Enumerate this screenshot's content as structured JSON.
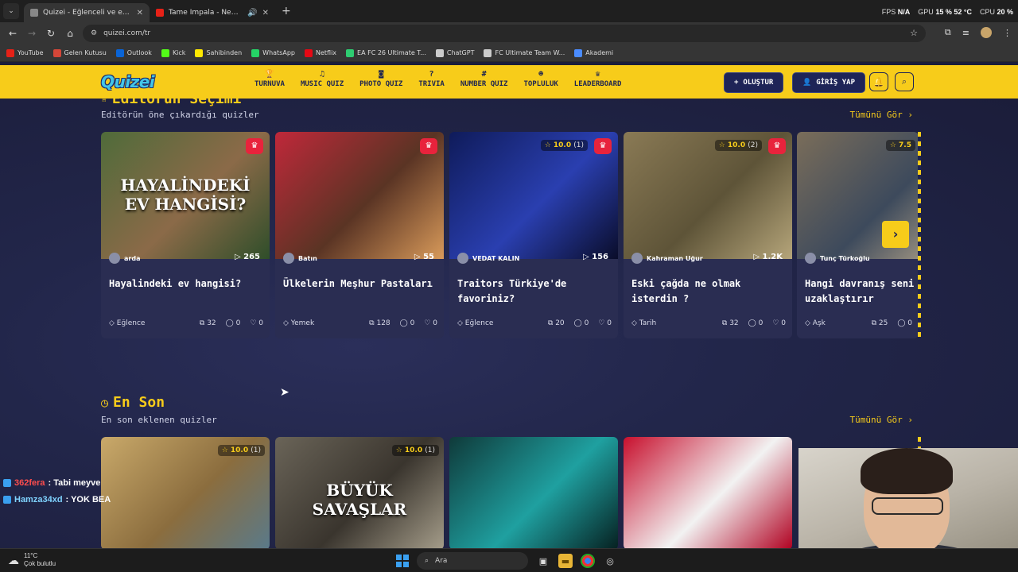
{
  "browser": {
    "tabs": [
      {
        "title": "Quizei - Eğlenceli ve etkileşimli",
        "active": true,
        "color": "#888888"
      },
      {
        "title": "Tame Impala - New Person, Sam",
        "active": false,
        "color": "#e62117"
      }
    ],
    "url": "quizei.com/tr",
    "stats": {
      "fps_label": "FPS",
      "fps_value": "N/A",
      "gpu_label": "GPU",
      "gpu_value": "15 % 52 °C",
      "cpu_label": "CPU",
      "cpu_value": "20 %"
    },
    "bookmarks": [
      {
        "label": "YouTube",
        "color": "#e62117"
      },
      {
        "label": "Gelen Kutusu",
        "color": "#d44638"
      },
      {
        "label": "Outlook",
        "color": "#0a64d6"
      },
      {
        "label": "Kick",
        "color": "#53fc18"
      },
      {
        "label": "Sahibinden",
        "color": "#ffe800"
      },
      {
        "label": "WhatsApp",
        "color": "#25d366"
      },
      {
        "label": "Netflix",
        "color": "#e50914"
      },
      {
        "label": "EA FC 26 Ultimate T...",
        "color": "#2ecc71"
      },
      {
        "label": "ChatGPT",
        "color": "#cccccc"
      },
      {
        "label": "FC Ultimate Team W...",
        "color": "#cccccc"
      },
      {
        "label": "Akademi",
        "color": "#4a8cff"
      }
    ]
  },
  "site": {
    "logo": "Quizei",
    "nav": [
      {
        "label": "TURNUVA",
        "icon": "trophy-icon",
        "glyph": "🏆"
      },
      {
        "label": "MUSIC QUIZ",
        "icon": "music-icon",
        "glyph": "♫"
      },
      {
        "label": "PHOTO QUIZ",
        "icon": "camera-icon",
        "glyph": "◙"
      },
      {
        "label": "TRIVIA",
        "icon": "question-icon",
        "glyph": "?"
      },
      {
        "label": "NUMBER QUIZ",
        "icon": "hash-icon",
        "glyph": "#"
      },
      {
        "label": "TOPLULUK",
        "icon": "users-icon",
        "glyph": "☻"
      },
      {
        "label": "LEADERBOARD",
        "icon": "medal-icon",
        "glyph": "♛"
      }
    ],
    "create_label": "OLUŞTUR",
    "login_label": "GİRİŞ YAP"
  },
  "editors": {
    "title": "Editörün Seçimi",
    "subtitle": "Editörün öne çıkardığı quizler",
    "see_all": "Tümünü Gör",
    "cards": [
      {
        "title": "Hayalindeki ev hangisi?",
        "author": "arda",
        "plays": "265",
        "category": "Eğlence",
        "questions": "32",
        "comments": "0",
        "likes": "0",
        "crown": true,
        "rating": "",
        "rating_count": "",
        "img_text": "HAYALİNDEKİ EV HANGİSİ?",
        "img_colors": [
          "#4f6b3a",
          "#8b6a48",
          "#2f4e2a"
        ]
      },
      {
        "title": "Ülkelerin Meşhur Pastaları",
        "author": "Batın",
        "plays": "55",
        "category": "Yemek",
        "questions": "128",
        "comments": "0",
        "likes": "0",
        "crown": true,
        "rating": "",
        "rating_count": "",
        "img_text": "",
        "img_colors": [
          "#c0283a",
          "#5a3424",
          "#d89a5a"
        ]
      },
      {
        "title": "Traitors Türkiye'de favoriniz?",
        "author": "VEDAT KALIN",
        "plays": "156",
        "category": "Eğlence",
        "questions": "20",
        "comments": "0",
        "likes": "0",
        "crown": true,
        "rating": "10.0",
        "rating_count": "(1)",
        "img_text": "",
        "img_colors": [
          "#0f1b5a",
          "#2a3fb0",
          "#0a0d2a"
        ]
      },
      {
        "title": "Eski çağda ne olmak isterdin ?",
        "author": "Kahraman Uğur",
        "plays": "1.2K",
        "category": "Tarih",
        "questions": "32",
        "comments": "0",
        "likes": "0",
        "crown": true,
        "rating": "10.0",
        "rating_count": "(2)",
        "img_text": "",
        "img_colors": [
          "#8a7a55",
          "#5e5438",
          "#b5a57a"
        ]
      },
      {
        "title": "Hangi davranış seni anında uzaklaştırır",
        "author": "Tunç Türkoğlu",
        "plays": "",
        "category": "Aşk",
        "questions": "25",
        "comments": "0",
        "likes": "",
        "crown": false,
        "rating": "7.5",
        "rating_count": "",
        "img_text": "",
        "img_colors": [
          "#7a6d5a",
          "#3d4a5c",
          "#c4b090"
        ]
      }
    ]
  },
  "latest": {
    "title": "En Son",
    "subtitle": "En son eklenen quizler",
    "see_all": "Tümünü Gör",
    "cards": [
      {
        "rating": "10.0",
        "rating_count": "(1)",
        "img_text": "",
        "img_colors": [
          "#c9a96a",
          "#8b6d3e",
          "#5a7a8a"
        ]
      },
      {
        "rating": "10.0",
        "rating_count": "(1)",
        "img_text": "BÜYÜK SAVAŞLAR",
        "img_colors": [
          "#6a6458",
          "#3a352e",
          "#a59d8a"
        ]
      },
      {
        "rating": "",
        "rating_count": "",
        "img_text": "",
        "img_colors": [
          "#0f3a3a",
          "#1fa0a0",
          "#062020"
        ]
      },
      {
        "rating": "",
        "rating_count": "",
        "img_text": "",
        "img_colors": [
          "#c8102e",
          "#f2f2f2",
          "#b00020"
        ]
      }
    ]
  },
  "chat": [
    {
      "user": "362fera",
      "message": ": Tabi meyve",
      "color": "#ff4d4d"
    },
    {
      "user": "Hamza34xd",
      "message": ": YOK BEA",
      "color": "#7fd3ff"
    }
  ],
  "taskbar": {
    "temperature": "11°C",
    "weather": "Çok bulutlu",
    "search_placeholder": "Ara"
  }
}
